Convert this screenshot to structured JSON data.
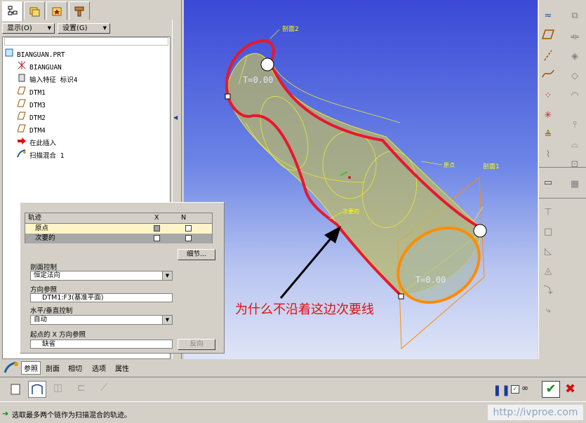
{
  "left_panel": {
    "show_button": "显示(O)",
    "settings_button": "设置(G)",
    "tree": [
      {
        "label": "BIANGUAN.PRT",
        "icon": "part-icon"
      },
      {
        "label": "BIANGUAN",
        "icon": "csys-icon"
      },
      {
        "label": "输入特征 标识4",
        "icon": "import-feature-icon"
      },
      {
        "label": "DTM1",
        "icon": "datum-plane-icon"
      },
      {
        "label": "DTM3",
        "icon": "datum-plane-icon"
      },
      {
        "label": "DTM2",
        "icon": "datum-plane-icon"
      },
      {
        "label": "DTM4",
        "icon": "datum-plane-icon"
      },
      {
        "label": "在此插入",
        "icon": "insert-here-arrow-icon"
      },
      {
        "label": "扫描混合 1",
        "icon": "swept-blend-icon"
      }
    ]
  },
  "viewport": {
    "labels": {
      "section2": "剖面2",
      "section1": "剖面1",
      "origin": "原点",
      "secondary": "次要的",
      "t_top": "T=0.00",
      "t_bottom": "T=0.00"
    },
    "annotation": "为什么不沿着这边次要线"
  },
  "dialog": {
    "table_headers": {
      "col1": "轨迹",
      "col2": "X",
      "col3": "N"
    },
    "rows": [
      {
        "label": "原点",
        "x_checked": true,
        "n_checked": false
      },
      {
        "label": "次要的",
        "x_checked": false,
        "n_checked": false
      }
    ],
    "details_button": "细节...",
    "section_control_label": "剖面控制",
    "section_control_value": "恒定法向",
    "direction_ref_label": "方向参照",
    "direction_ref_value": "DTM1:F3(基准平面)",
    "hv_control_label": "水平/垂直控制",
    "hv_control_value": "自动",
    "start_x_label": "起点的 X 方向参照",
    "start_x_value": "缺省",
    "flip_button": "反向"
  },
  "dashboard": {
    "tabs": [
      "参照",
      "剖面",
      "相切",
      "选项",
      "属性"
    ]
  },
  "status": {
    "message": "选取最多两个链作为扫描混合的轨迹。",
    "watermark": "http://ivproe.com"
  },
  "colors": {
    "viewport_top": "#3b49d6",
    "trajectory_red": "#e8182c",
    "section_orange": "#ff8c00",
    "surface_yellow": "#b8b86a",
    "confirm_green": "#1a8f1a"
  }
}
